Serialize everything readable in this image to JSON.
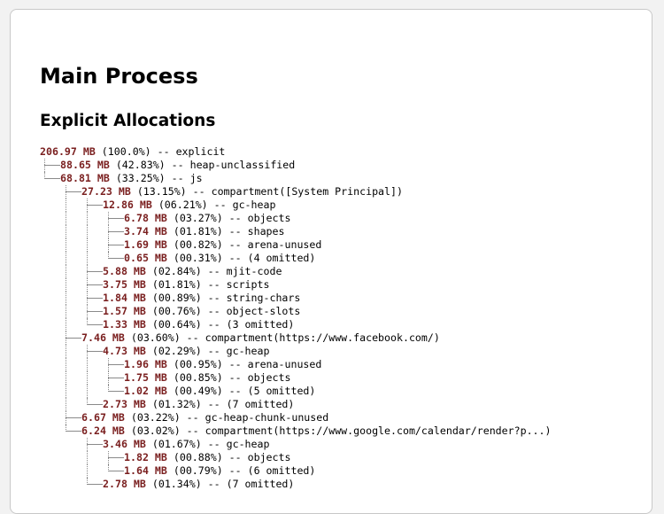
{
  "heading": "Main Process",
  "section": "Explicit Allocations",
  "tree": [
    {
      "depth": 0,
      "amount": "206.97 MB",
      "rest": " (100.0%) -- explicit",
      "last": true
    },
    {
      "depth": 1,
      "amount": "88.65 MB",
      "rest": " (42.83%) -- heap-unclassified",
      "last": false
    },
    {
      "depth": 1,
      "amount": "68.81 MB",
      "rest": " (33.25%) -- js",
      "last": false
    },
    {
      "depth": 2,
      "amount": "27.23 MB",
      "rest": " (13.15%) -- compartment([System Principal])",
      "last": false
    },
    {
      "depth": 3,
      "amount": "12.86 MB",
      "rest": " (06.21%) -- gc-heap",
      "last": false
    },
    {
      "depth": 4,
      "amount": "6.78 MB",
      "rest": " (03.27%) -- objects",
      "last": false
    },
    {
      "depth": 4,
      "amount": "3.74 MB",
      "rest": " (01.81%) -- shapes",
      "last": false
    },
    {
      "depth": 4,
      "amount": "1.69 MB",
      "rest": " (00.82%) -- arena-unused",
      "last": false
    },
    {
      "depth": 4,
      "amount": "0.65 MB",
      "rest": " (00.31%) -- (4 omitted)",
      "last": true
    },
    {
      "depth": 3,
      "amount": "5.88 MB",
      "rest": " (02.84%) -- mjit-code",
      "last": false
    },
    {
      "depth": 3,
      "amount": "3.75 MB",
      "rest": " (01.81%) -- scripts",
      "last": false
    },
    {
      "depth": 3,
      "amount": "1.84 MB",
      "rest": " (00.89%) -- string-chars",
      "last": false
    },
    {
      "depth": 3,
      "amount": "1.57 MB",
      "rest": " (00.76%) -- object-slots",
      "last": false
    },
    {
      "depth": 3,
      "amount": "1.33 MB",
      "rest": " (00.64%) -- (3 omitted)",
      "last": true
    },
    {
      "depth": 2,
      "amount": "7.46 MB",
      "rest": " (03.60%) -- compartment(https://www.facebook.com/)",
      "last": false
    },
    {
      "depth": 3,
      "amount": "4.73 MB",
      "rest": " (02.29%) -- gc-heap",
      "last": false
    },
    {
      "depth": 4,
      "amount": "1.96 MB",
      "rest": " (00.95%) -- arena-unused",
      "last": false
    },
    {
      "depth": 4,
      "amount": "1.75 MB",
      "rest": " (00.85%) -- objects",
      "last": false
    },
    {
      "depth": 4,
      "amount": "1.02 MB",
      "rest": " (00.49%) -- (5 omitted)",
      "last": true
    },
    {
      "depth": 3,
      "amount": "2.73 MB",
      "rest": " (01.32%) -- (7 omitted)",
      "last": true
    },
    {
      "depth": 2,
      "amount": "6.67 MB",
      "rest": " (03.22%) -- gc-heap-chunk-unused",
      "last": false
    },
    {
      "depth": 2,
      "amount": "6.24 MB",
      "rest": " (03.02%) -- compartment(https://www.google.com/calendar/render?p...)",
      "last": false
    },
    {
      "depth": 3,
      "amount": "3.46 MB",
      "rest": " (01.67%) -- gc-heap",
      "last": false
    },
    {
      "depth": 4,
      "amount": "1.82 MB",
      "rest": " (00.88%) -- objects",
      "last": false
    },
    {
      "depth": 4,
      "amount": "1.64 MB",
      "rest": " (00.79%) -- (6 omitted)",
      "last": true
    },
    {
      "depth": 3,
      "amount": "2.78 MB",
      "rest": " (01.34%) -- (7 omitted)",
      "last": true
    }
  ]
}
